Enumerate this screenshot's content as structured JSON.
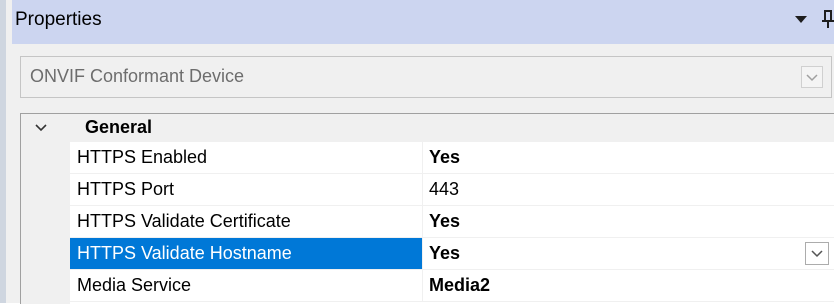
{
  "panel": {
    "title": "Properties"
  },
  "selector": {
    "value": "ONVIF Conformant Device"
  },
  "category": {
    "label": "General"
  },
  "properties": [
    {
      "name": "HTTPS Enabled",
      "value": "Yes"
    },
    {
      "name": "HTTPS Port",
      "value": "443"
    },
    {
      "name": "HTTPS Validate Certificate",
      "value": "Yes"
    },
    {
      "name": "HTTPS Validate Hostname",
      "value": "Yes"
    },
    {
      "name": "Media Service",
      "value": "Media2"
    }
  ],
  "colors": {
    "titlebar": "#ccd5f0",
    "selection": "#0078d7",
    "gridline": "#f0f0f0"
  },
  "icons": {
    "title_dropdown": "triangle-down-icon",
    "pin": "pin-icon",
    "selector_dropdown": "chevron-down-icon",
    "category_toggle": "chevron-down-icon",
    "value_dropdown": "chevron-down-icon"
  }
}
